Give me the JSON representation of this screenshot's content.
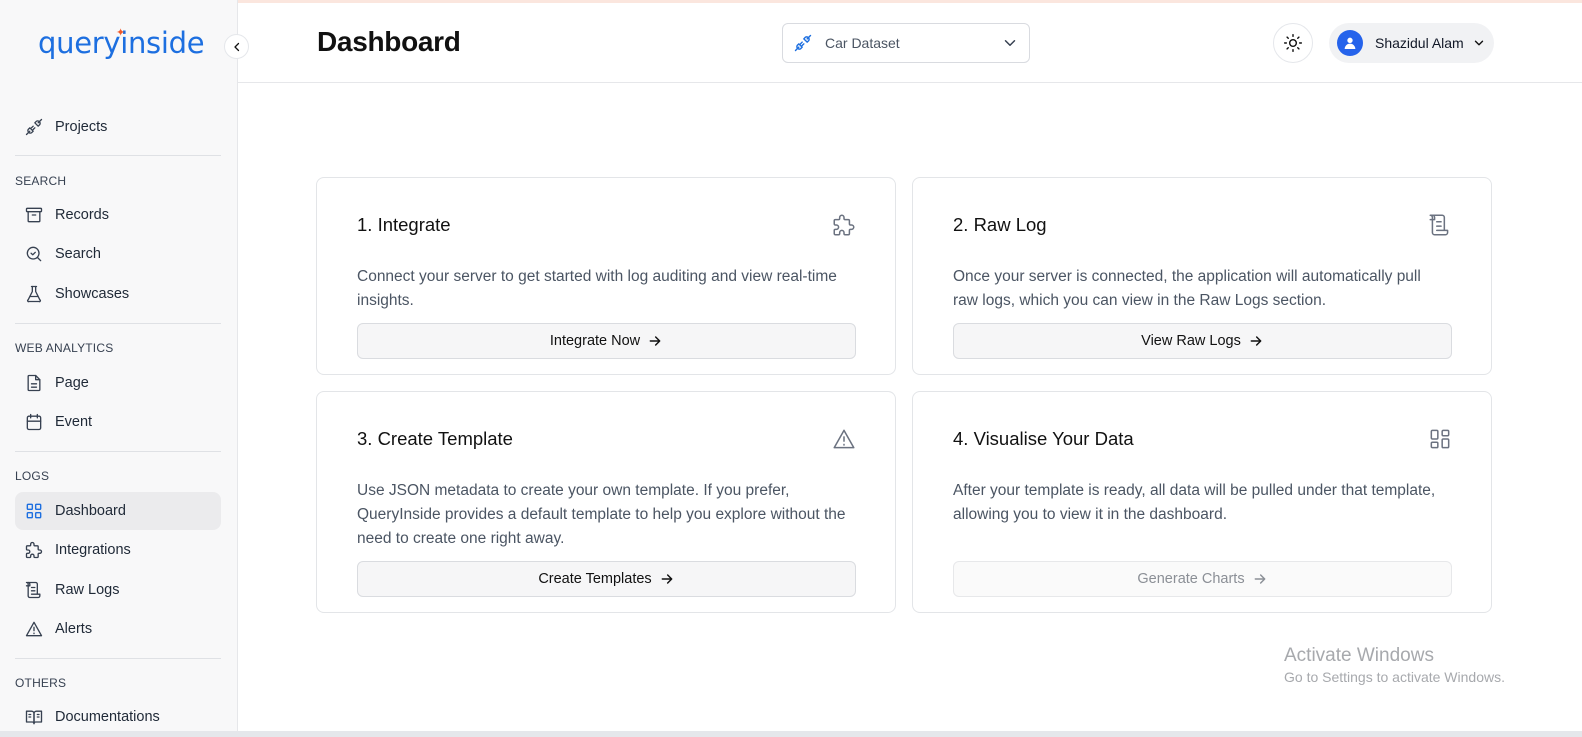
{
  "brand": {
    "logo_text": "queryinside",
    "accent": "#1d6fe0",
    "spark_color": "#f15a2a"
  },
  "sidebar": {
    "projects_label": "Projects",
    "sections": {
      "search": "SEARCH",
      "web_analytics": "WEB ANALYTICS",
      "logs": "LOGS",
      "others": "OTHERS"
    },
    "items": {
      "records": "Records",
      "search": "Search",
      "showcases": "Showcases",
      "page": "Page",
      "event": "Event",
      "dashboard": "Dashboard",
      "integrations": "Integrations",
      "raw_logs": "Raw Logs",
      "alerts": "Alerts",
      "documentations": "Documentations"
    },
    "active_item": "dashboard"
  },
  "header": {
    "title": "Dashboard",
    "dataset_selected": "Car Dataset",
    "user_name": "Shazidul Alam"
  },
  "cards": [
    {
      "title": "1. Integrate",
      "icon": "puzzle-icon",
      "description": "Connect your server to get started with log auditing and view real-time insights.",
      "button": "Integrate Now"
    },
    {
      "title": "2. Raw Log",
      "icon": "scroll-icon",
      "description": "Once your server is connected, the application will automatically pull raw logs, which you can view in the Raw Logs section.",
      "button": "View Raw Logs"
    },
    {
      "title": "3. Create Template",
      "icon": "alert-triangle-icon",
      "description": "Use JSON metadata to create your own template. If you prefer, QueryInside provides a default template to help you explore without the need to create one right away.",
      "button": "Create Templates"
    },
    {
      "title": "4. Visualise Your Data",
      "icon": "dashboard-grid-icon",
      "description": "After your template is ready, all data will be pulled under that template, allowing you to view it in the dashboard.",
      "button": "Generate Charts"
    }
  ],
  "watermark": {
    "line1": "Activate Windows",
    "line2": "Go to Settings to activate Windows."
  }
}
